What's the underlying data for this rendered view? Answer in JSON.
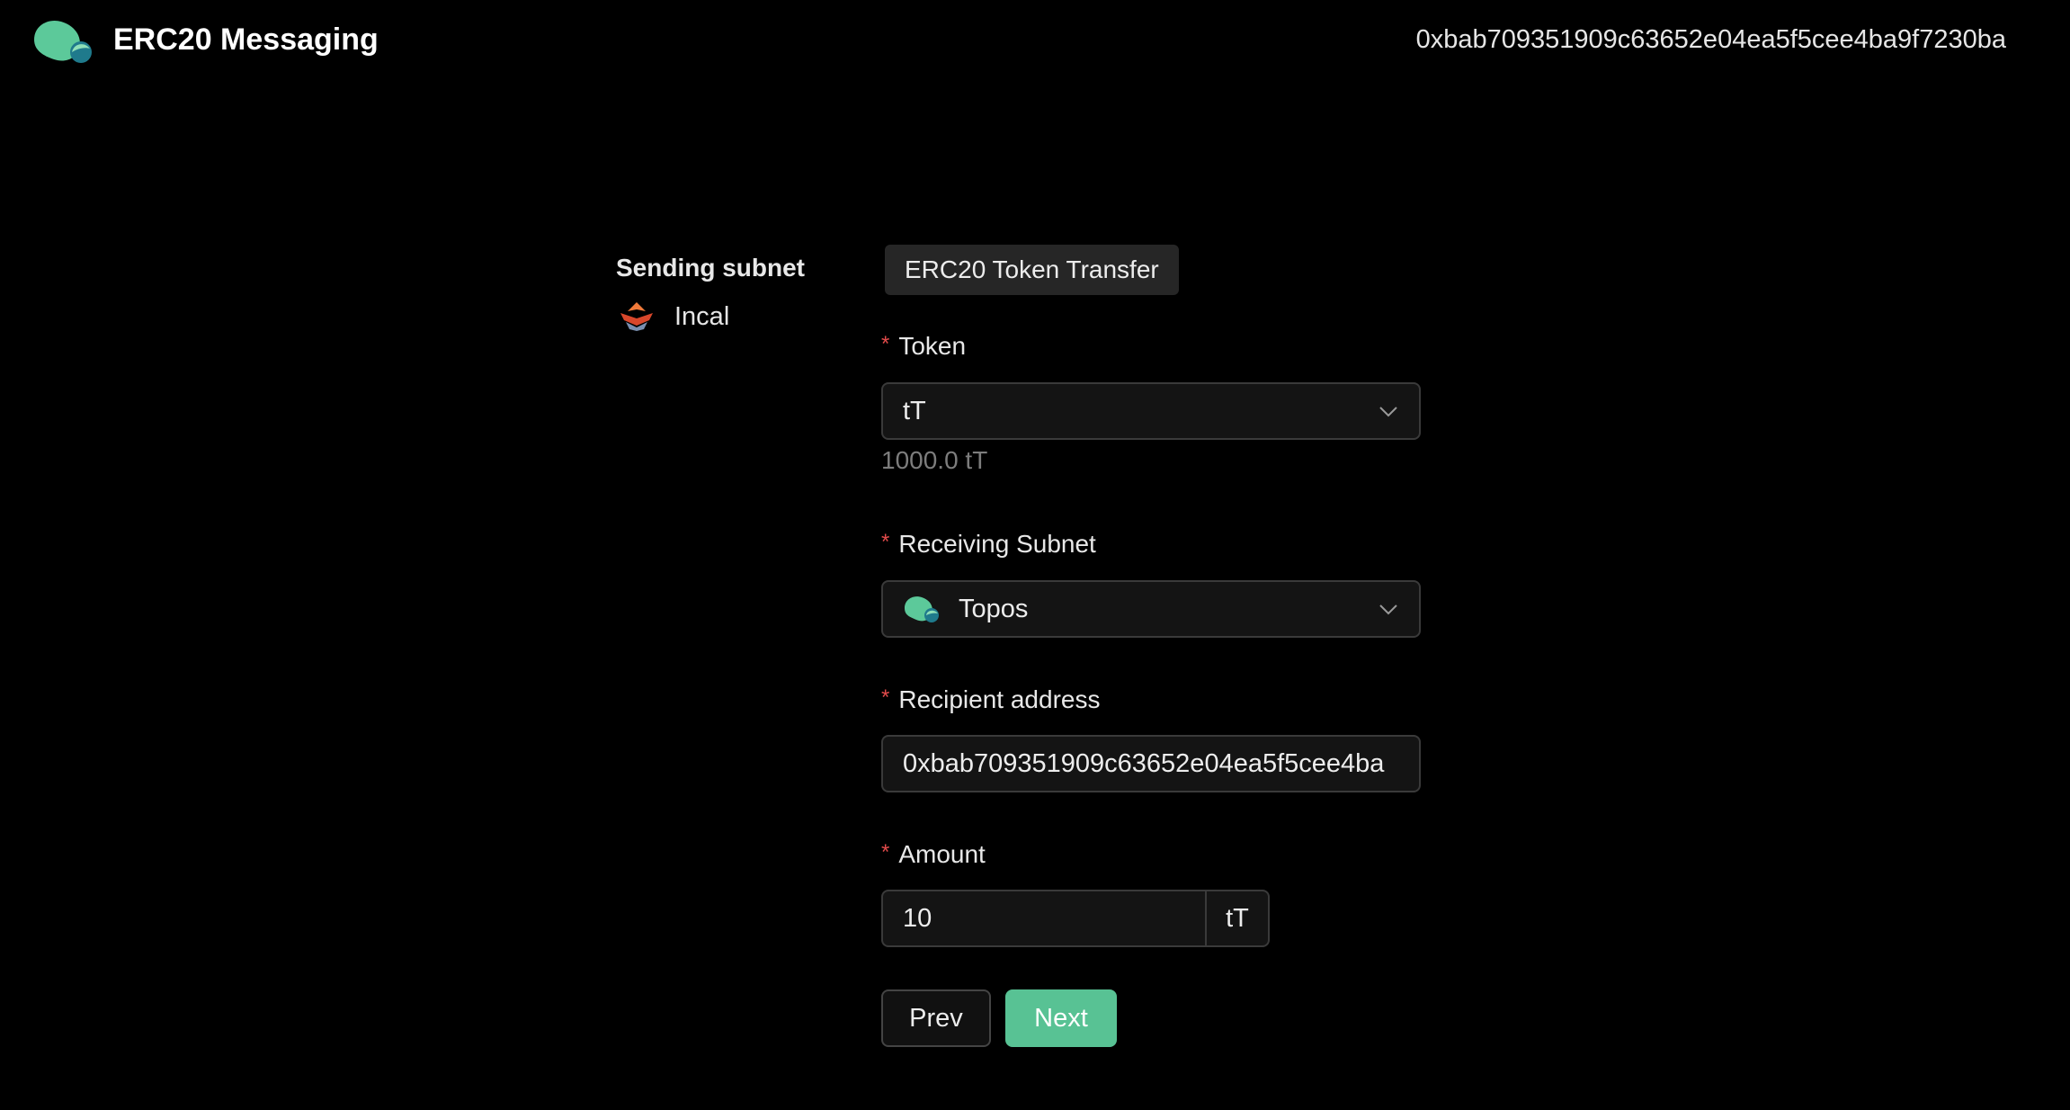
{
  "header": {
    "logo_icon": "topos-logo-icon",
    "title": "ERC20 Messaging",
    "wallet_address": "0xbab709351909c63652e04ea5f5cee4ba9f7230ba"
  },
  "sending": {
    "label": "Sending subnet",
    "subnet_icon": "incal-icon",
    "subnet_name": "Incal"
  },
  "form": {
    "step_tab": "ERC20 Token Transfer",
    "required_marker": "*",
    "token": {
      "label": "Token",
      "value": "tT",
      "balance": "1000.0 tT"
    },
    "receiving_subnet": {
      "label": "Receiving Subnet",
      "icon": "topos-icon",
      "value": "Topos"
    },
    "recipient": {
      "label": "Recipient address",
      "value": "0xbab709351909c63652e04ea5f5cee4ba"
    },
    "amount": {
      "label": "Amount",
      "value": "10",
      "unit": "tT"
    },
    "buttons": {
      "prev": "Prev",
      "next": "Next"
    }
  },
  "colors": {
    "background": "#000000",
    "accent": "#58c294",
    "required": "#e34b4b"
  }
}
